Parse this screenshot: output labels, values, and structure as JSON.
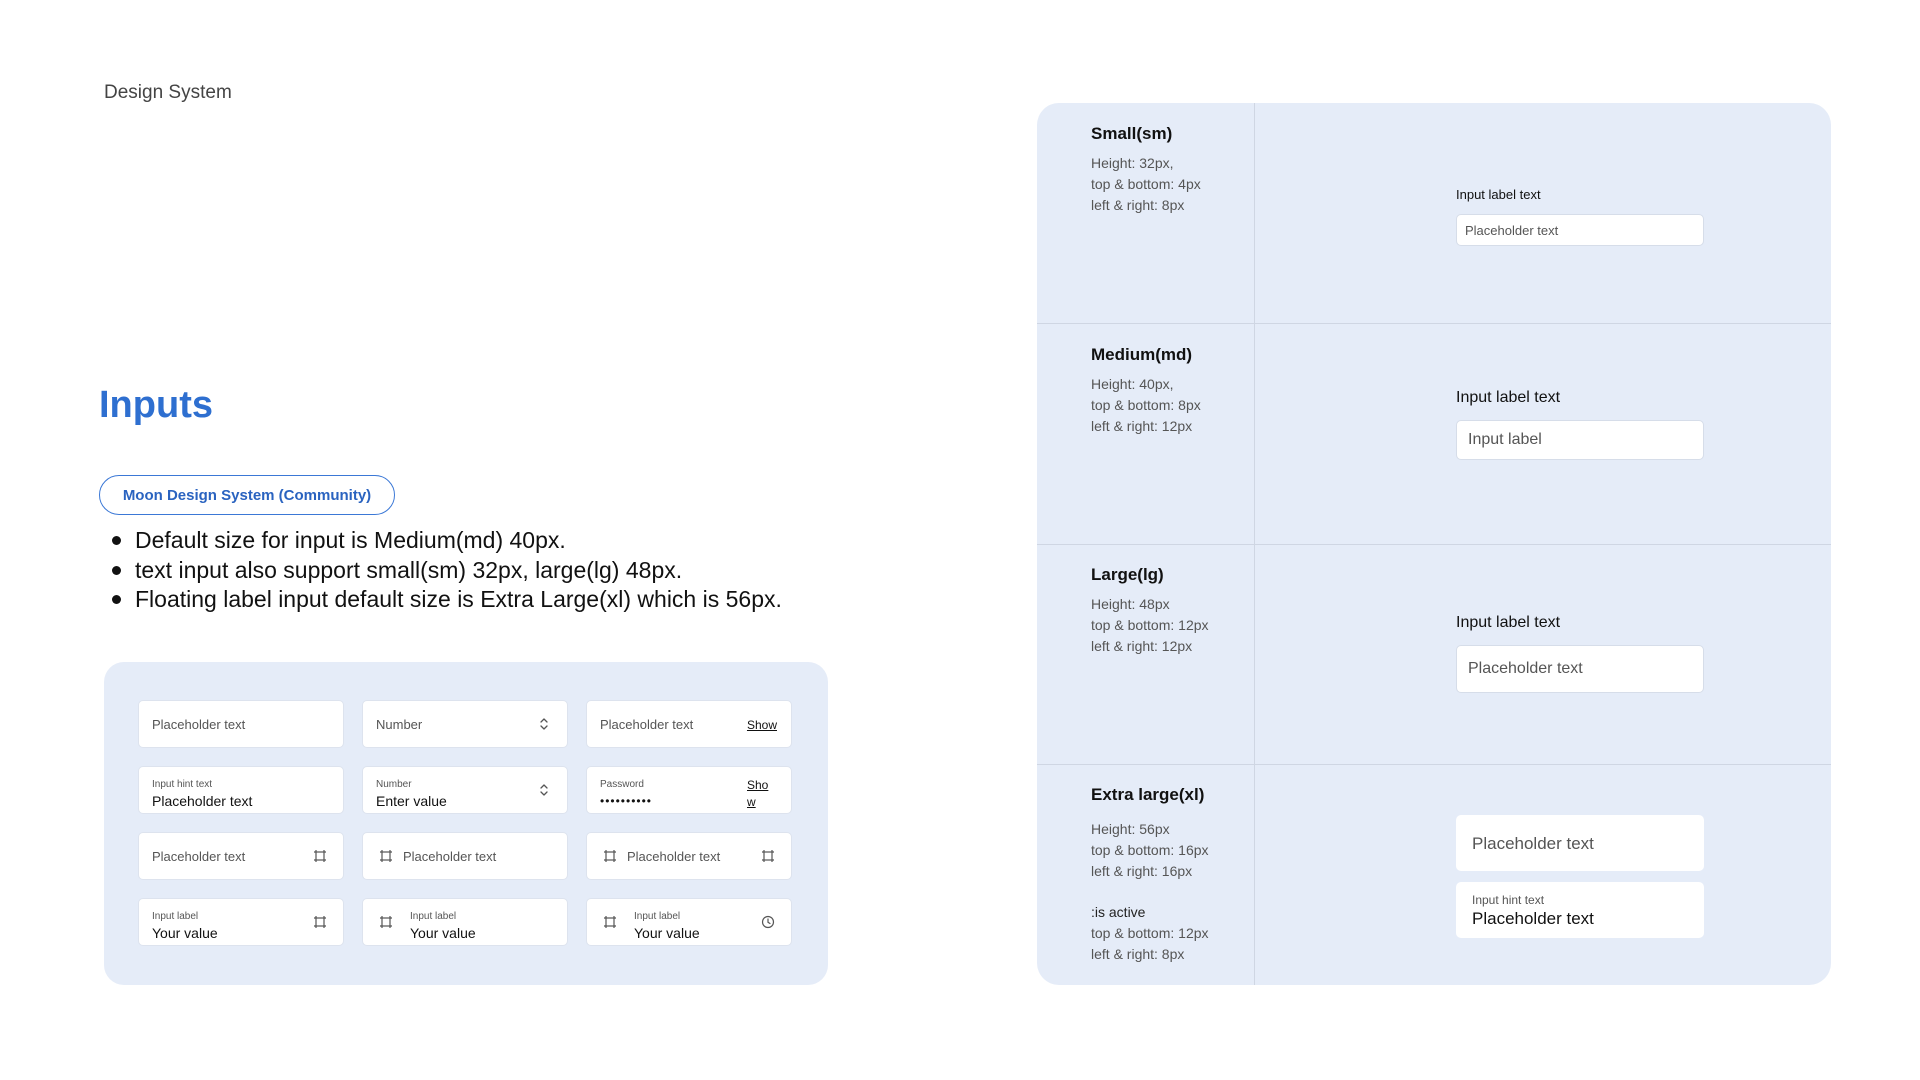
{
  "header": {
    "brand": "Design System"
  },
  "page": {
    "title": "Inputs",
    "tag": "Moon Design System (Community)",
    "bullets": [
      "Default size for input is Medium(md) 40px.",
      "text input also support small(sm) 32px, large(lg) 48px.",
      "Floating label input default size is Extra Large(xl) which is 56px."
    ]
  },
  "examples": {
    "row1": {
      "text_placeholder": "Placeholder text",
      "number_placeholder": "Number",
      "password_placeholder": "Placeholder text",
      "show_label": "Show"
    },
    "row2": {
      "text_hint": "Input hint text",
      "text_value": "Placeholder text",
      "number_hint": "Number",
      "number_value": "Enter value",
      "password_hint": "Password",
      "password_value": "••••••••••",
      "show_label": "Show"
    },
    "row3": {
      "a_placeholder": "Placeholder text",
      "b_placeholder": "Placeholder text",
      "c_placeholder": "Placeholder text"
    },
    "row4": {
      "a_label": "Input label",
      "a_value": "Your value",
      "b_label": "Input label",
      "b_value": "Your value",
      "c_label": "Input label",
      "c_value": "Your value"
    },
    "icons": [
      "chevron-updown-icon",
      "crop-frame-icon",
      "clock-icon"
    ]
  },
  "sizes": [
    {
      "title": "Small(sm)",
      "desc": [
        "Height: 32px,",
        "top & bottom: 4px",
        "left & right: 8px"
      ],
      "label": "Input label text",
      "placeholder": "Placeholder text"
    },
    {
      "title": "Medium(md)",
      "desc": [
        "Height: 40px,",
        "top & bottom: 8px",
        "left & right: 12px"
      ],
      "label": "Input label text",
      "placeholder": "Input label"
    },
    {
      "title": "Large(lg)",
      "desc": [
        "Height: 48px",
        "top & bottom: 12px",
        "left & right: 12px"
      ],
      "label": "Input label text",
      "placeholder": "Placeholder text"
    },
    {
      "title": "Extra large(xl)",
      "desc": [
        "Height: 56px",
        "top & bottom: 16px",
        "left & right: 16px"
      ],
      "active_desc": [
        ":is active",
        "top & bottom: 12px",
        "left & right: 8px"
      ],
      "placeholder": "Placeholder text",
      "hint": "Input hint text",
      "value": "Placeholder text"
    }
  ],
  "colors": {
    "accent": "#2e6fd0",
    "panel_bg": "#e5ecf8",
    "border": "#dde3ee"
  }
}
